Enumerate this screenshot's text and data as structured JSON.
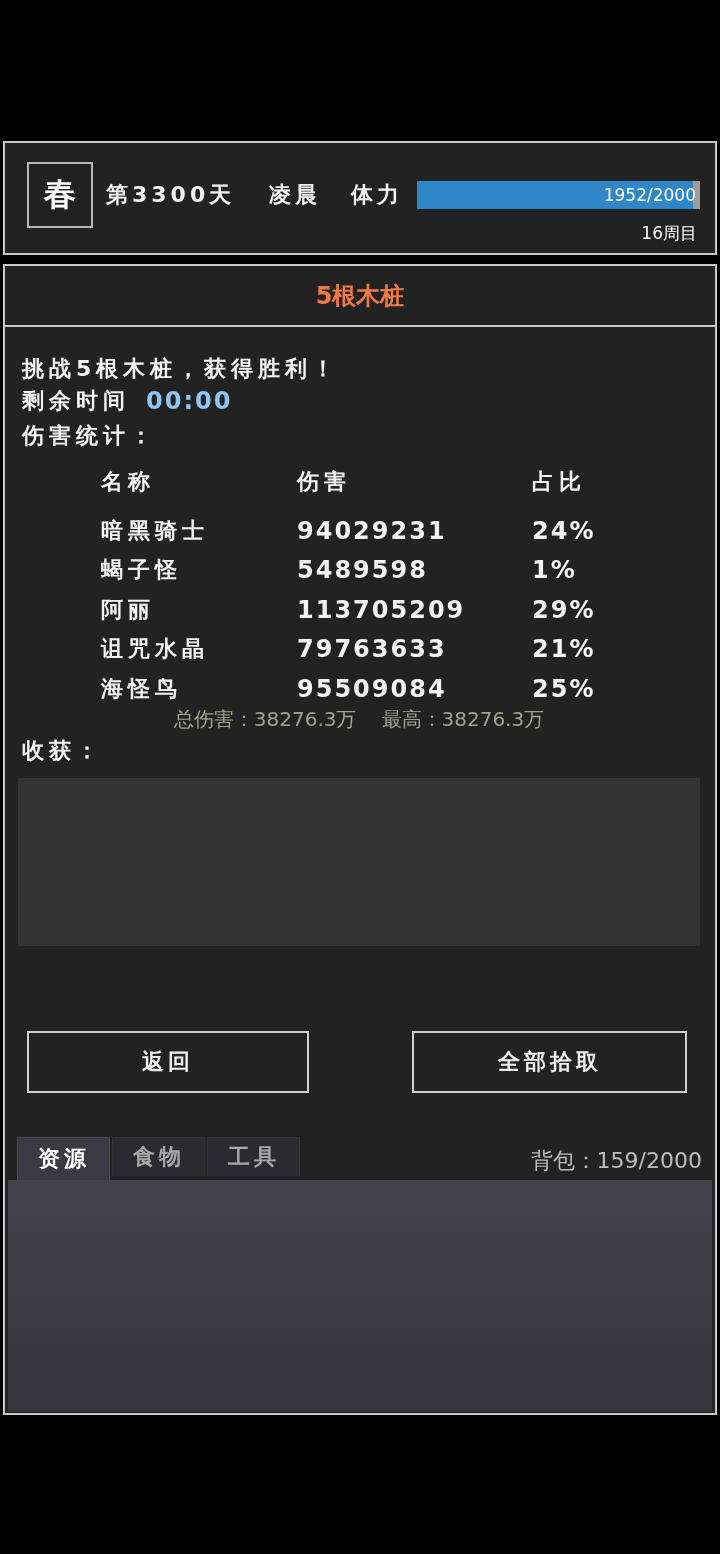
{
  "header": {
    "season": "春",
    "day": "第3300天",
    "time_of_day": "凌晨",
    "stamina": {
      "label": "体力",
      "level": 0.976,
      "reading": "1952/2000"
    },
    "cycle": "16周目"
  },
  "battle": {
    "title": "5根木桩",
    "result": "挑战5根木桩，获得胜利！",
    "timer": {
      "label": "剩余时间",
      "value": "00:00"
    },
    "stats_heading": "伤害统计：",
    "table": {
      "columns": [
        "名称",
        "伤害",
        "占比"
      ],
      "rows": [
        [
          "暗黑骑士",
          "94029231",
          "24%"
        ],
        [
          "蝎子怪",
          "5489598",
          "1%"
        ],
        [
          "阿丽",
          "113705209",
          "29%"
        ],
        [
          "诅咒水晶",
          "79763633",
          "21%"
        ],
        [
          "海怪鸟",
          "95509084",
          "25%"
        ]
      ]
    },
    "total": "总伤害：38276.3万",
    "best": "最高：38276.3万",
    "loot_heading": "收获："
  },
  "buttons": [
    "返回",
    "全部拾取"
  ],
  "inventory": {
    "tabs": [
      {
        "label": "资源",
        "selected": true
      },
      {
        "label": "食物",
        "selected": false
      },
      {
        "label": "工具",
        "selected": false
      }
    ],
    "capacity": "背包：159/2000"
  }
}
